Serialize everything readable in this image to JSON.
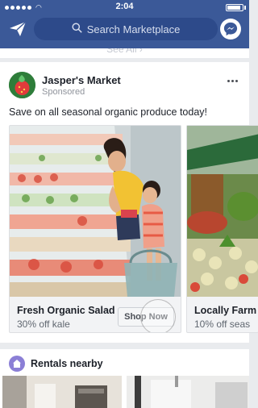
{
  "status_bar": {
    "time": "2:04"
  },
  "header": {
    "search_placeholder": "Search Marketplace",
    "colors": {
      "bar": "#3b5998",
      "search_bg": "#2d4a8a"
    },
    "icons": [
      "paper-plane-icon",
      "search-icon",
      "messenger-icon"
    ]
  },
  "see_all": {
    "label": "See All"
  },
  "post": {
    "advertiser": "Jasper's Market",
    "sponsored_label": "Sponsored",
    "caption": "Save on all seasonal organic produce today!",
    "items": [
      {
        "title": "Fresh Organic Salad",
        "subtitle": "30% off kale",
        "button": "Shop Now"
      },
      {
        "title": "Locally Farm",
        "subtitle": "10% off seas"
      }
    ]
  },
  "rentals": {
    "title": "Rentals nearby",
    "icon": "house-icon"
  }
}
